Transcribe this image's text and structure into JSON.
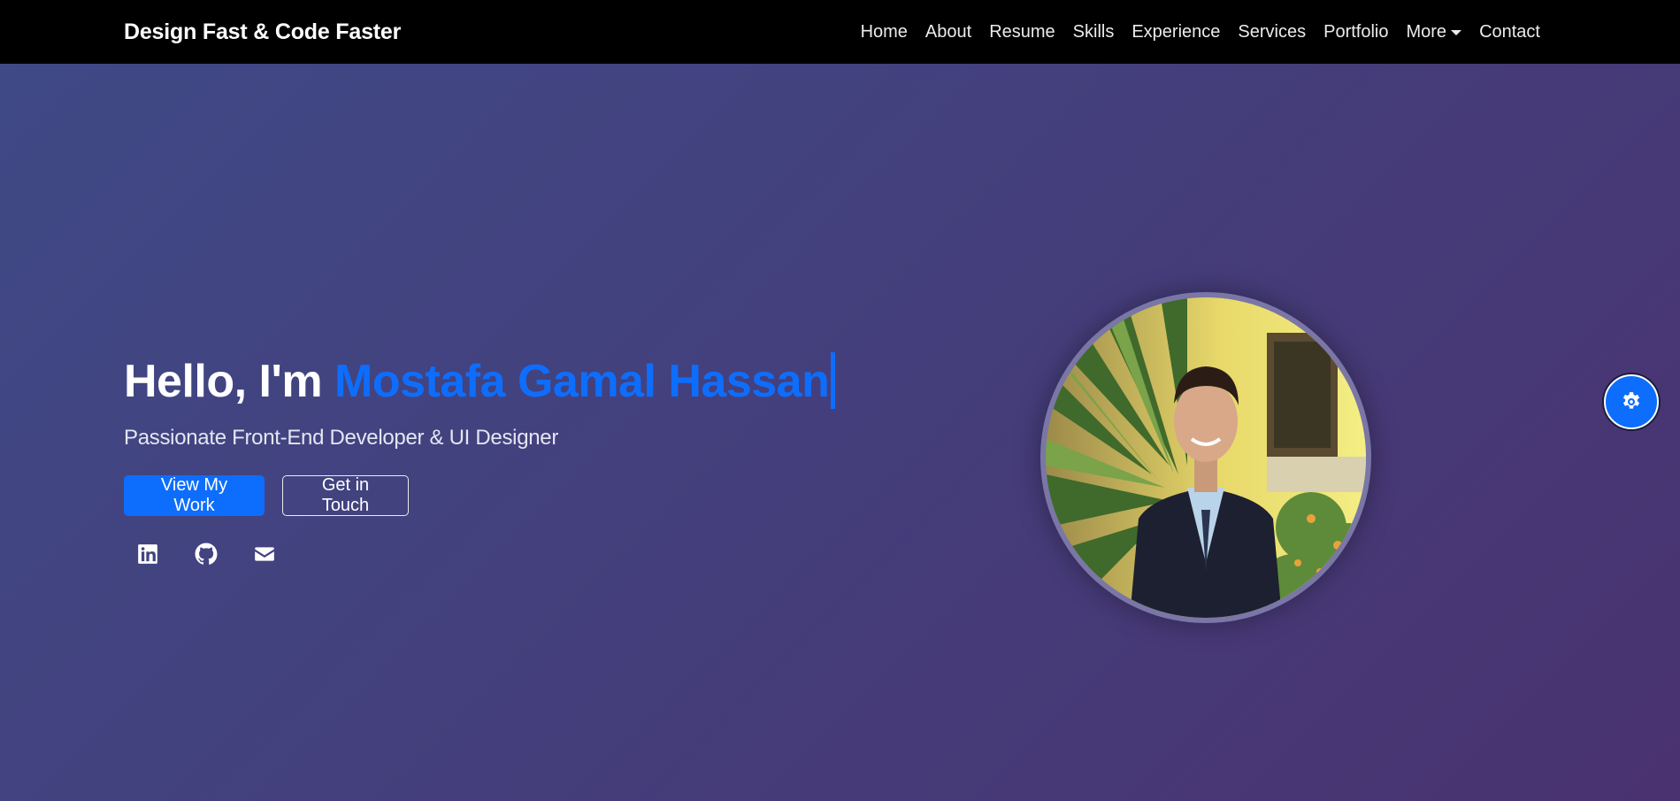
{
  "brand": "Design Fast & Code Faster",
  "nav": {
    "items": [
      {
        "label": "Home"
      },
      {
        "label": "About"
      },
      {
        "label": "Resume"
      },
      {
        "label": "Skills"
      },
      {
        "label": "Experience"
      },
      {
        "label": "Services"
      },
      {
        "label": "Portfolio"
      },
      {
        "label": "More"
      },
      {
        "label": "Contact"
      }
    ]
  },
  "hero": {
    "greeting": "Hello, I'm ",
    "name": "Mostafa Gamal Hassan",
    "subtitle": "Passionate Front-End Developer & UI Designer",
    "primary_button": "View My Work",
    "secondary_button": "Get in Touch"
  },
  "social": {
    "icons": [
      "linkedin-icon",
      "github-icon",
      "envelope-icon"
    ]
  },
  "floating": {
    "icon": "gear-icon"
  },
  "colors": {
    "accent": "#0d6efd",
    "navbar": "#000000",
    "background_start": "#3f4a86",
    "background_end": "#4a3270"
  }
}
